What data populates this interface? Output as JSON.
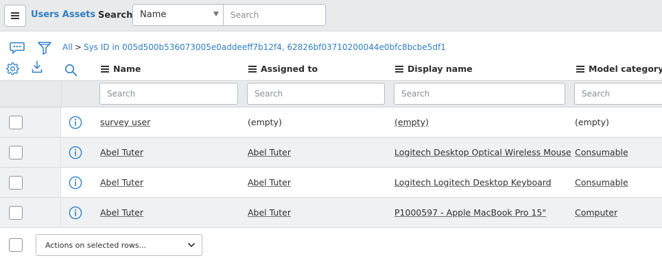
{
  "header": {
    "menu_icon": "hamburger-icon",
    "title": "Users Assets",
    "search_label": "Search",
    "search_field": "Name",
    "search_placeholder": "Search"
  },
  "toolbar": {
    "icons": [
      "chat-icon",
      "filter-icon",
      "gear-icon",
      "download-icon",
      "search-icon"
    ],
    "breadcrumb": {
      "all": "All",
      "separator": ">",
      "condition": "Sys ID in 005d500b536073005e0addeeff7b12f4, 62826bf03710200044e0bfc8bcbe5df1"
    }
  },
  "columns": [
    {
      "label": "Name",
      "search_placeholder": "Search"
    },
    {
      "label": "Assigned to",
      "search_placeholder": "Search"
    },
    {
      "label": "Display name",
      "search_placeholder": "Search"
    },
    {
      "label": "Model category",
      "search_placeholder": "Search"
    }
  ],
  "rows": [
    {
      "name": "survey user",
      "assigned_to": "(empty)",
      "display_name": "(empty)",
      "model_category": "(empty)"
    },
    {
      "name": "Abel Tuter",
      "assigned_to": "Abel Tuter",
      "display_name": "Logitech Desktop Optical Wireless Mouse",
      "model_category": "Consumable"
    },
    {
      "name": "Abel Tuter",
      "assigned_to": "Abel Tuter",
      "display_name": "Logitech Logitech Desktop Keyboard",
      "model_category": "Consumable"
    },
    {
      "name": "Abel Tuter",
      "assigned_to": "Abel Tuter",
      "display_name": "P1000597 - Apple MacBook Pro 15\"",
      "model_category": "Computer"
    }
  ],
  "footer": {
    "actions_label": "Actions on selected rows..."
  },
  "colors": {
    "accent": "#2e7ec4",
    "header_bg": "#e9eaeb",
    "row_alt_bg": "#f0f1f2"
  }
}
